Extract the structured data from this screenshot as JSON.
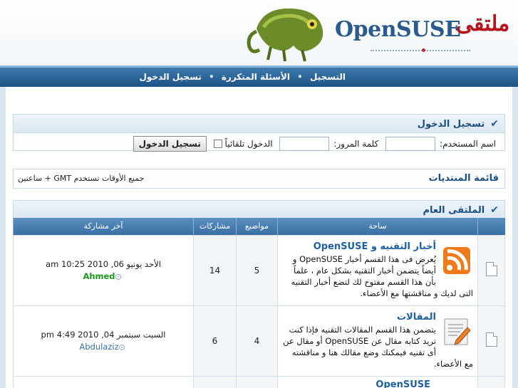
{
  "header": {
    "logo_text": "OpenSUSE",
    "logo_arabic": "ملتقى"
  },
  "nav": {
    "items": [
      "التسجيل",
      "الأسئلة المتكررة",
      "تسجيل الدخول"
    ],
    "separator": "•"
  },
  "login": {
    "title": "تسجيل الدخول",
    "username_label": "اسم المستخدم:",
    "password_label": "كلمة المرور:",
    "remember_label": "الدخول تلقائياً",
    "submit_label": "تسجيل الدخول",
    "username_value": "",
    "password_value": ""
  },
  "forum_index": {
    "title": "قائمة المنتديات",
    "timezone": "جميع الأوقات تستخدم GMT + ساعتين"
  },
  "category": {
    "title": "الملتقى العام",
    "columns": {
      "forum": "ساحة",
      "topics": "مواضيع",
      "posts": "مشاركات",
      "last_post": "آخر مشاركة"
    },
    "forums": [
      {
        "title": "أخبار التقنيه و OpenSUSE",
        "description": "يُعرض فى هذا القسم أخبار OpenSUSE و أيضاً يتضمن أخبار التقنيه بشكل عام ، علماً بأن هذا القسم مفتوح لك لتضع أخبار التقنيه التى لديك و مناقشتها مع الأعضاء.",
        "topics": "5",
        "posts": "14",
        "last_date": "الأحد يونيو 06, 2010 10:25 am",
        "last_user": "Ahmed",
        "icon": "rss-icon"
      },
      {
        "title": "المقالات",
        "description": "يتضمن هذا القسم المقالات التقنيه فإذا كنت تريد كتابه مقال عن OpenSUSE أو مقال عن أى تقنيه فيمكنك وضع مقالك هنا و مناقشته مع الأعضاء.",
        "topics": "4",
        "posts": "6",
        "last_date": "السبت سبتمبر 04, 2010 4:49 pm",
        "last_user": "Abdulaziz",
        "icon": "article-icon"
      },
      {
        "title": "OpenSUSE",
        "description": "",
        "topics": "",
        "posts": "",
        "last_date": "",
        "last_user": "",
        "icon": "forum-icon"
      }
    ]
  },
  "colors": {
    "navbar": "#1e5486",
    "link": "#1d5fa0",
    "logo_red": "#b4141a",
    "user_green": "#1a9a1a"
  }
}
